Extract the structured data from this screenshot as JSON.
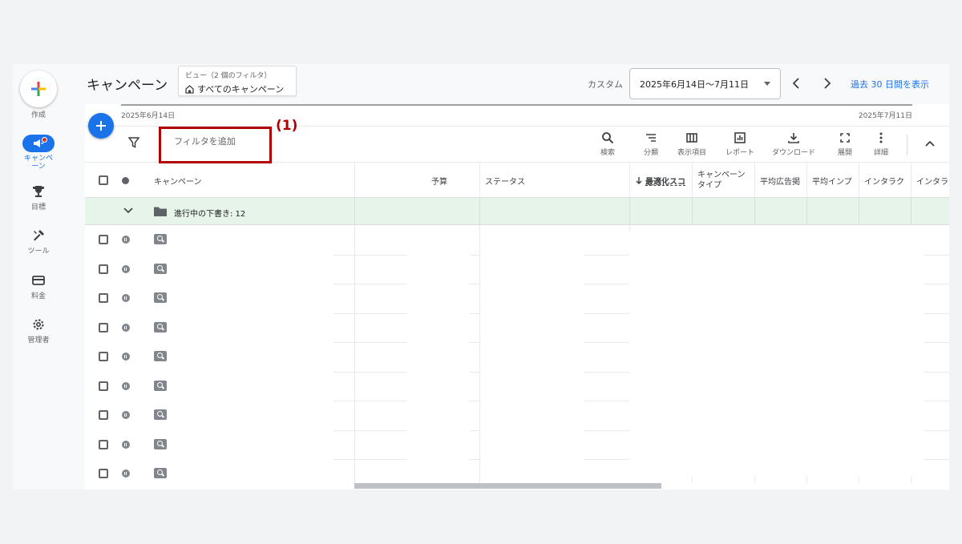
{
  "rail": {
    "create_label": "作成",
    "items": [
      {
        "label": "キャンペーン",
        "icon": "megaphone-icon",
        "active": true
      },
      {
        "label": "目標",
        "icon": "trophy-icon"
      },
      {
        "label": "ツール",
        "icon": "tools-icon"
      },
      {
        "label": "料金",
        "icon": "credit-card-icon"
      },
      {
        "label": "管理者",
        "icon": "gear-icon"
      }
    ]
  },
  "header": {
    "title": "キャンペーン",
    "view_sub": "ビュー（2 個のフィルタ）",
    "view_main": "すべてのキャンペーン",
    "custom_label": "カスタム",
    "date_range": "2025年6月14日〜7月11日",
    "show_30": "過去 30 日間を表示"
  },
  "timeline": {
    "start": "2025年6月14日",
    "end": "2025年7月11日"
  },
  "toolbar": {
    "filter_placeholder": "フィルタを追加",
    "tools": [
      {
        "label": "検索",
        "icon": "search-icon"
      },
      {
        "label": "分類",
        "icon": "segment-icon"
      },
      {
        "label": "表示項目",
        "icon": "columns-icon"
      },
      {
        "label": "レポート",
        "icon": "report-icon"
      },
      {
        "label": "ダウンロード",
        "icon": "download-icon"
      },
      {
        "label": "展開",
        "icon": "expand-icon"
      },
      {
        "label": "詳細",
        "icon": "more-icon"
      }
    ]
  },
  "table": {
    "columns": [
      "キャンペーン",
      "予算",
      "ステータス",
      "最適化スコ",
      "キャンペーン\nタイプ",
      "平均広告掲",
      "平均インプ",
      "インタラク",
      "インタラク"
    ],
    "group_label": "進行中の下書き: 12",
    "row_count": 9
  },
  "annotation": {
    "label": "(1)"
  },
  "colors": {
    "accent": "#1a73e8",
    "group_bg": "#e6f4ea",
    "annotation": "#b00000"
  }
}
